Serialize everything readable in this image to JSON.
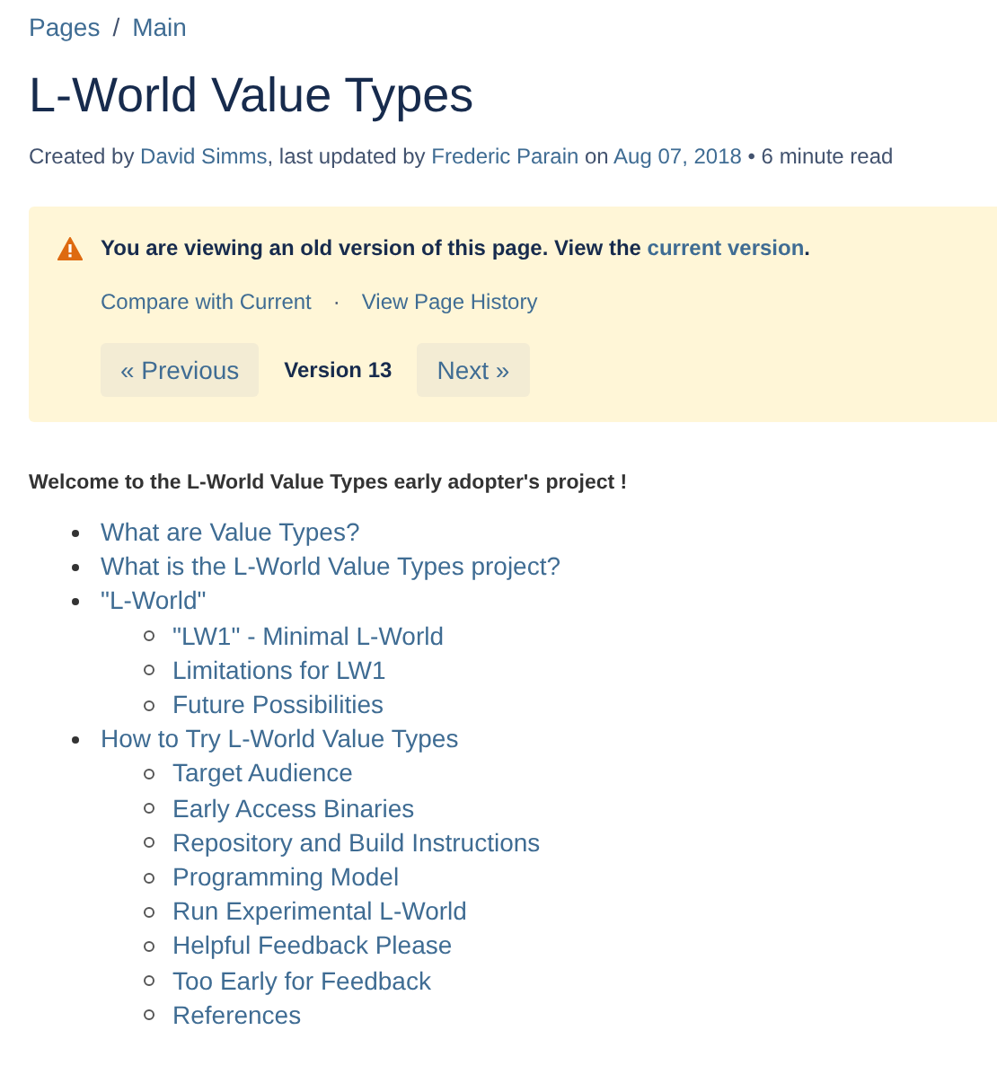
{
  "breadcrumb": [
    {
      "label": "Pages"
    },
    {
      "label": "Main"
    }
  ],
  "breadcrumb_separator": "/",
  "title": "L-World Value Types",
  "byline": [
    {
      "kind": "text",
      "text": "Created by "
    },
    {
      "kind": "link",
      "text": "David Simms"
    },
    {
      "kind": "text",
      "text": ", last updated by "
    },
    {
      "kind": "link",
      "text": "Frederic Parain"
    },
    {
      "kind": "text",
      "text": " on "
    },
    {
      "kind": "link",
      "text": "Aug 07, 2018"
    },
    {
      "kind": "text",
      "text": " • 6 minute read"
    }
  ],
  "notice": {
    "message": [
      {
        "kind": "text",
        "text": "You are viewing an old version of this page. View the "
      },
      {
        "kind": "link",
        "text": "current version"
      },
      {
        "kind": "text",
        "text": "."
      }
    ],
    "links": [
      "Compare with Current",
      "View Page History"
    ],
    "link_separator": "·",
    "previous_button": "« Previous",
    "version": "Version 13",
    "next_button": "Next »"
  },
  "intro": "Welcome to the L-World Value Types early adopter's project !",
  "contents": [
    {
      "label": "What are Value Types?"
    },
    {
      "label": "What is the L-World Value Types project?"
    },
    {
      "label": "\"L-World\"",
      "children": [
        {
          "label": "\"LW1\" - Minimal L-World"
        },
        {
          "label": "Limitations for LW1"
        },
        {
          "label": "Future Possibilities"
        }
      ]
    },
    {
      "label": "How to Try L-World Value Types",
      "children": [
        {
          "label": "Target Audience"
        },
        {
          "label": "Early Access Binaries"
        },
        {
          "label": "Repository and Build Instructions"
        },
        {
          "label": "Programming Model"
        },
        {
          "label": "Run Experimental L-World"
        },
        {
          "label": "Helpful Feedback Please"
        },
        {
          "label": "Too Early for Feedback"
        },
        {
          "label": "References"
        }
      ]
    }
  ]
}
